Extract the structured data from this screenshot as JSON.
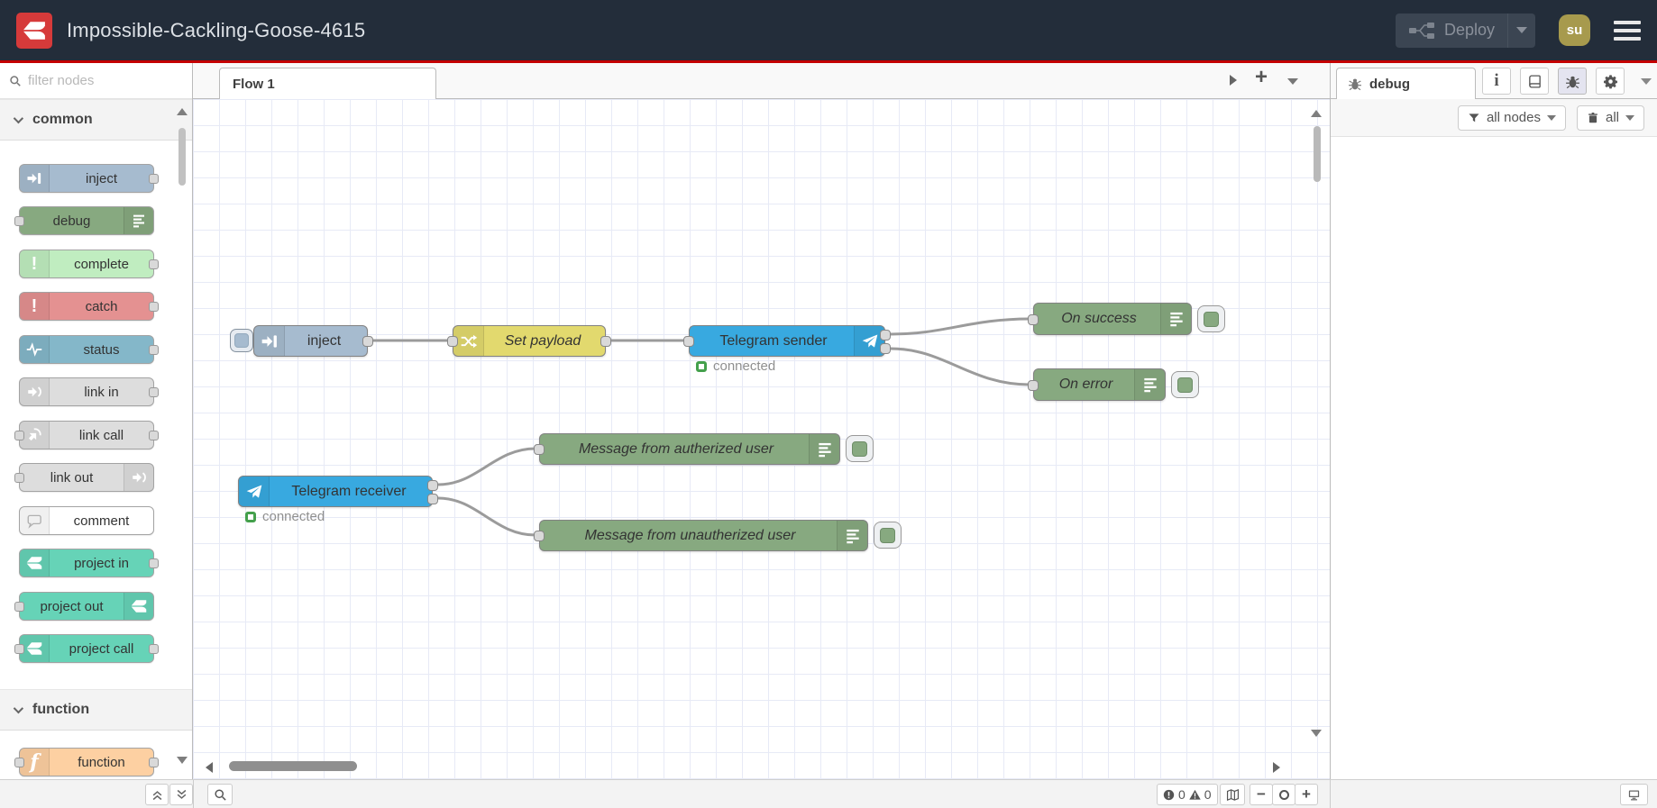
{
  "header": {
    "title": "Impossible-Cackling-Goose-4615",
    "deploy": {
      "label": "Deploy"
    },
    "avatar": {
      "initials": "su"
    },
    "colors": {
      "bar_bg": "#232d3a",
      "underline_red": "#c40000",
      "logo_red": "#d63a3a",
      "avatar_bg": "#a79a4d"
    }
  },
  "palette": {
    "search": {
      "placeholder": "filter nodes"
    },
    "categories": [
      {
        "label": "common",
        "nodes": [
          {
            "label": "inject",
            "color": "#a6bbcf",
            "icon": "inject-arrow-icon"
          },
          {
            "label": "debug",
            "color": "#87a980",
            "icon": "debug-list-icon"
          },
          {
            "label": "complete",
            "color": "#c0edc0",
            "icon": "exclamation-icon"
          },
          {
            "label": "catch",
            "color": "#e49191",
            "icon": "exclamation-icon"
          },
          {
            "label": "status",
            "color": "#84b7c9",
            "icon": "pulse-icon"
          },
          {
            "label": "link in",
            "color": "#dddddd",
            "icon": "link-icon"
          },
          {
            "label": "link call",
            "color": "#dddddd",
            "icon": "link-icon"
          },
          {
            "label": "link out",
            "color": "#dddddd",
            "icon": "link-icon"
          },
          {
            "label": "comment",
            "color": "#ffffff",
            "icon": "comment-bubble-icon"
          },
          {
            "label": "project in",
            "color": "#66d3b7",
            "icon": "node-red-icon"
          },
          {
            "label": "project out",
            "color": "#66d3b7",
            "icon": "node-red-icon"
          },
          {
            "label": "project call",
            "color": "#66d3b7",
            "icon": "node-red-icon"
          }
        ]
      },
      {
        "label": "function",
        "nodes": [
          {
            "label": "function",
            "color": "#fdd0a2",
            "icon": "function-f-icon"
          }
        ]
      }
    ]
  },
  "workspace": {
    "tab": {
      "label": "Flow 1"
    },
    "grid_color": "#e7eaf6",
    "wire_color": "#9b9b9b",
    "nodes": [
      {
        "label": "inject",
        "color": "#a6bbcf",
        "icon": "inject-arrow-icon"
      },
      {
        "label": "Set payload",
        "color": "#e2d96e",
        "icon": "change-shuffle-icon"
      },
      {
        "label": "Telegram sender",
        "color": "#38a9e0",
        "icon": "telegram-plane-icon",
        "status": "connected"
      },
      {
        "label": "On success",
        "color": "#87a980",
        "icon": "debug-list-icon"
      },
      {
        "label": "On error",
        "color": "#87a980",
        "icon": "debug-list-icon"
      },
      {
        "label": "Telegram receiver",
        "color": "#38a9e0",
        "icon": "telegram-plane-icon",
        "status": "connected"
      },
      {
        "label": "Message from autherized user",
        "color": "#87a980",
        "icon": "debug-list-icon"
      },
      {
        "label": "Message from unautherized user",
        "color": "#87a980",
        "icon": "debug-list-icon"
      }
    ]
  },
  "debug_panel": {
    "tab_label": "debug",
    "filter_button_label": "all nodes",
    "clear_button_label": "all"
  },
  "statusbar": {
    "error_count": "0",
    "warning_count": "0"
  }
}
